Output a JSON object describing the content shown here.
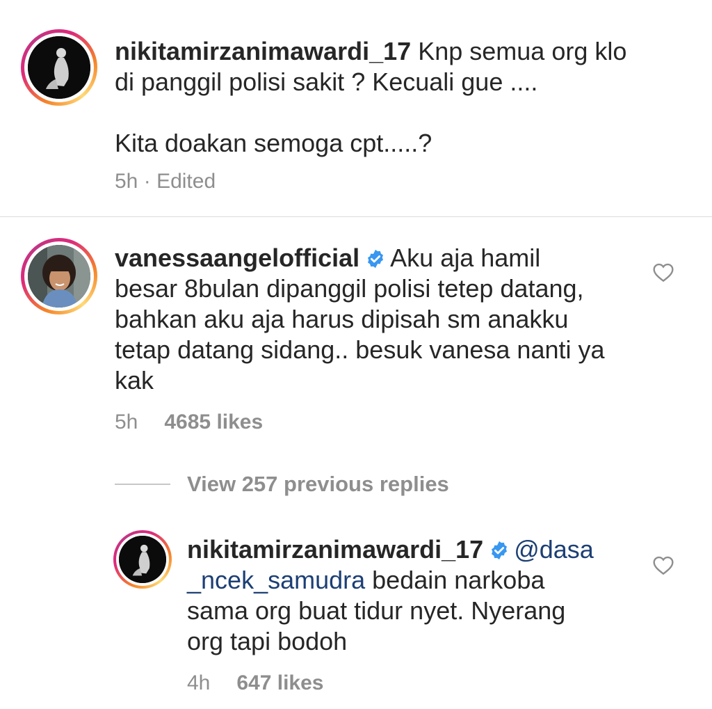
{
  "comment1": {
    "username": "nikitamirzanimawardi_17",
    "text_line1_rest": "Knp semua org klo",
    "text_line2": "di panggil polisi sakit ? Kecuali gue ....",
    "text_line4": "Kita doakan semoga cpt.....?",
    "time": "5h",
    "separator": "·",
    "edited": "Edited"
  },
  "comment2": {
    "username": "vanessaangelofficial",
    "text_line1_rest": "Aku aja hamil",
    "text_line2": "besar 8bulan dipanggil polisi tetep datang,",
    "text_line3": "bahkan aku aja harus dipisah sm anakku",
    "text_line4": "tetap datang sidang.. besuk vanesa nanti ya",
    "text_line5": "kak",
    "time": "5h",
    "likes": "4685 likes"
  },
  "view_replies": {
    "label": "View 257 previous replies"
  },
  "reply1": {
    "username": "nikitamirzanimawardi_17",
    "mention_part1": "@dasa",
    "mention_part2": "_ncek_samudra",
    "text_line2_rest": " bedain narkoba",
    "text_line3": "sama org buat tidur nyet. Nyerang",
    "text_line4": "org tapi bodoh",
    "time": "4h",
    "likes": "647 likes"
  },
  "icons": {
    "verified": "verified-badge-icon",
    "heart": "heart-outline-icon"
  },
  "colors": {
    "verified_blue": "#3897f0",
    "mention": "#1c3f74",
    "meta_gray": "#8e8e8e"
  }
}
